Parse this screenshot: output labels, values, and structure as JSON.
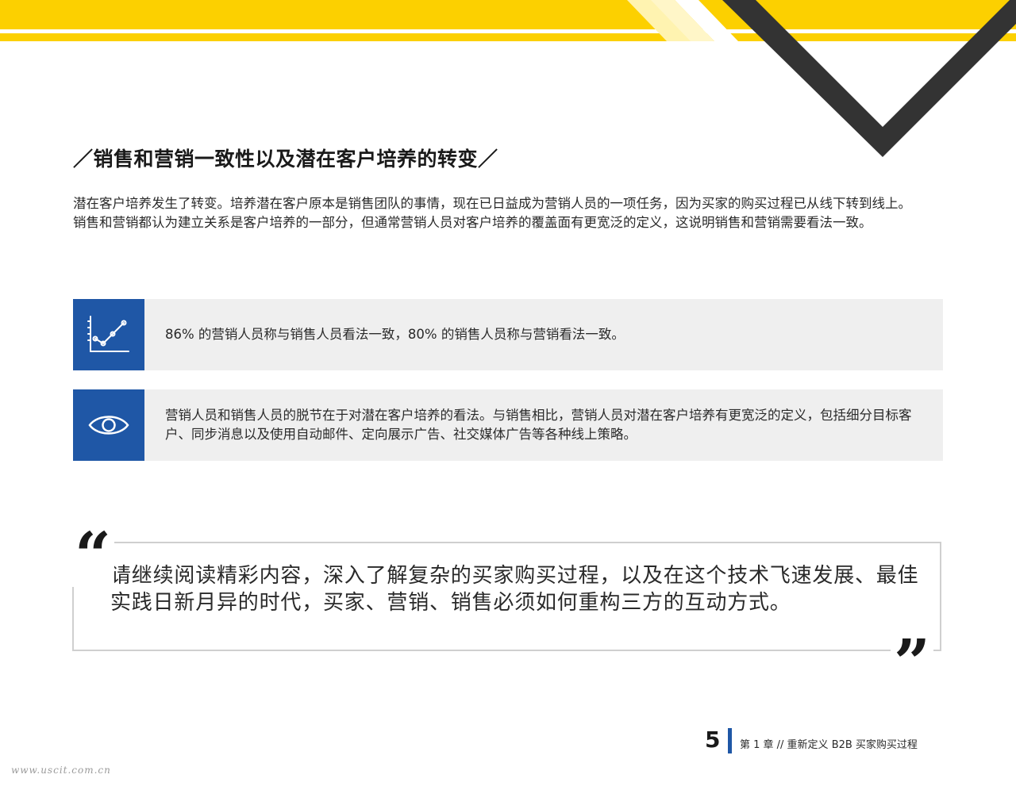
{
  "colors": {
    "brand_yellow": "#fcd000",
    "brand_blue": "#1f57a6",
    "dark_chevron": "#333333",
    "callout_bg": "#efefef"
  },
  "section": {
    "heading": "／销售和营销一致性以及潜在客户培养的转变／",
    "paragraphs": [
      "潜在客户培养发生了转变。培养潜在客户原本是销售团队的事情，现在已日益成为营销人员的一项任务，因为买家的购买过程已从线下转到线上。",
      "销售和营销都认为建立关系是客户培养的一部分，但通常营销人员对客户培养的覆盖面有更宽泛的定义，这说明销售和营销需要看法一致。"
    ]
  },
  "callouts": [
    {
      "icon": "line-chart-icon",
      "text": "86% 的营销人员称与销售人员看法一致，80% 的销售人员称与营销看法一致。"
    },
    {
      "icon": "eye-icon",
      "text": "营销人员和销售人员的脱节在于对潜在客户培养的看法。与销售相比，营销人员对潜在客户培养有更宽泛的定义，包括细分目标客户、同步消息以及使用自动邮件、定向展示广告、社交媒体广告等各种线上策略。"
    }
  ],
  "quote": {
    "open_mark": "“",
    "close_mark": "”",
    "text": "请继续阅读精彩内容，深入了解复杂的买家购买过程，以及在这个技术飞速发展、最佳实践日新月异的时代，买家、营销、销售必须如何重构三方的互动方式。"
  },
  "footer": {
    "page_number": "5",
    "chapter_text": "第 1 章 // 重新定义 B2B 买家购买过程"
  },
  "watermark": "www.uscit.com.cn"
}
